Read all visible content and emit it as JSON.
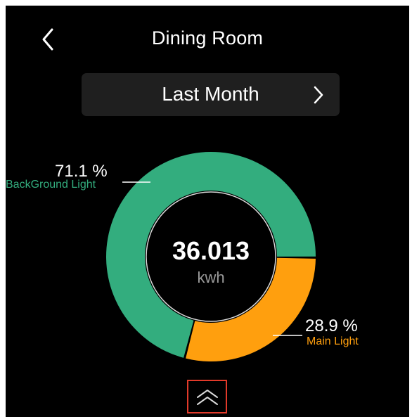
{
  "header": {
    "title": "Dining Room",
    "back_icon": "chevron-left-icon"
  },
  "period": {
    "label": "Last Month",
    "chevron_icon": "chevron-right-icon"
  },
  "summary": {
    "value": "36.013",
    "unit": "kwh"
  },
  "chart_data": {
    "type": "pie",
    "title": "",
    "total": 36.013,
    "unit": "kwh",
    "series": [
      {
        "name": "BackGround Light",
        "percent": 71.1,
        "percent_label": "71.1 %",
        "color": "#33ad7e"
      },
      {
        "name": "Main Light",
        "percent": 28.9,
        "percent_label": "28.9 %",
        "color": "#ff9f0e"
      }
    ]
  },
  "footer": {
    "collapse_icon": "double-chevron-up-icon",
    "highlight_color": "#e23a2a"
  },
  "colors": {
    "background": "#000000",
    "card": "#1f1f1f",
    "primary_text": "#ffffff",
    "secondary_text": "#9a9a9a"
  }
}
